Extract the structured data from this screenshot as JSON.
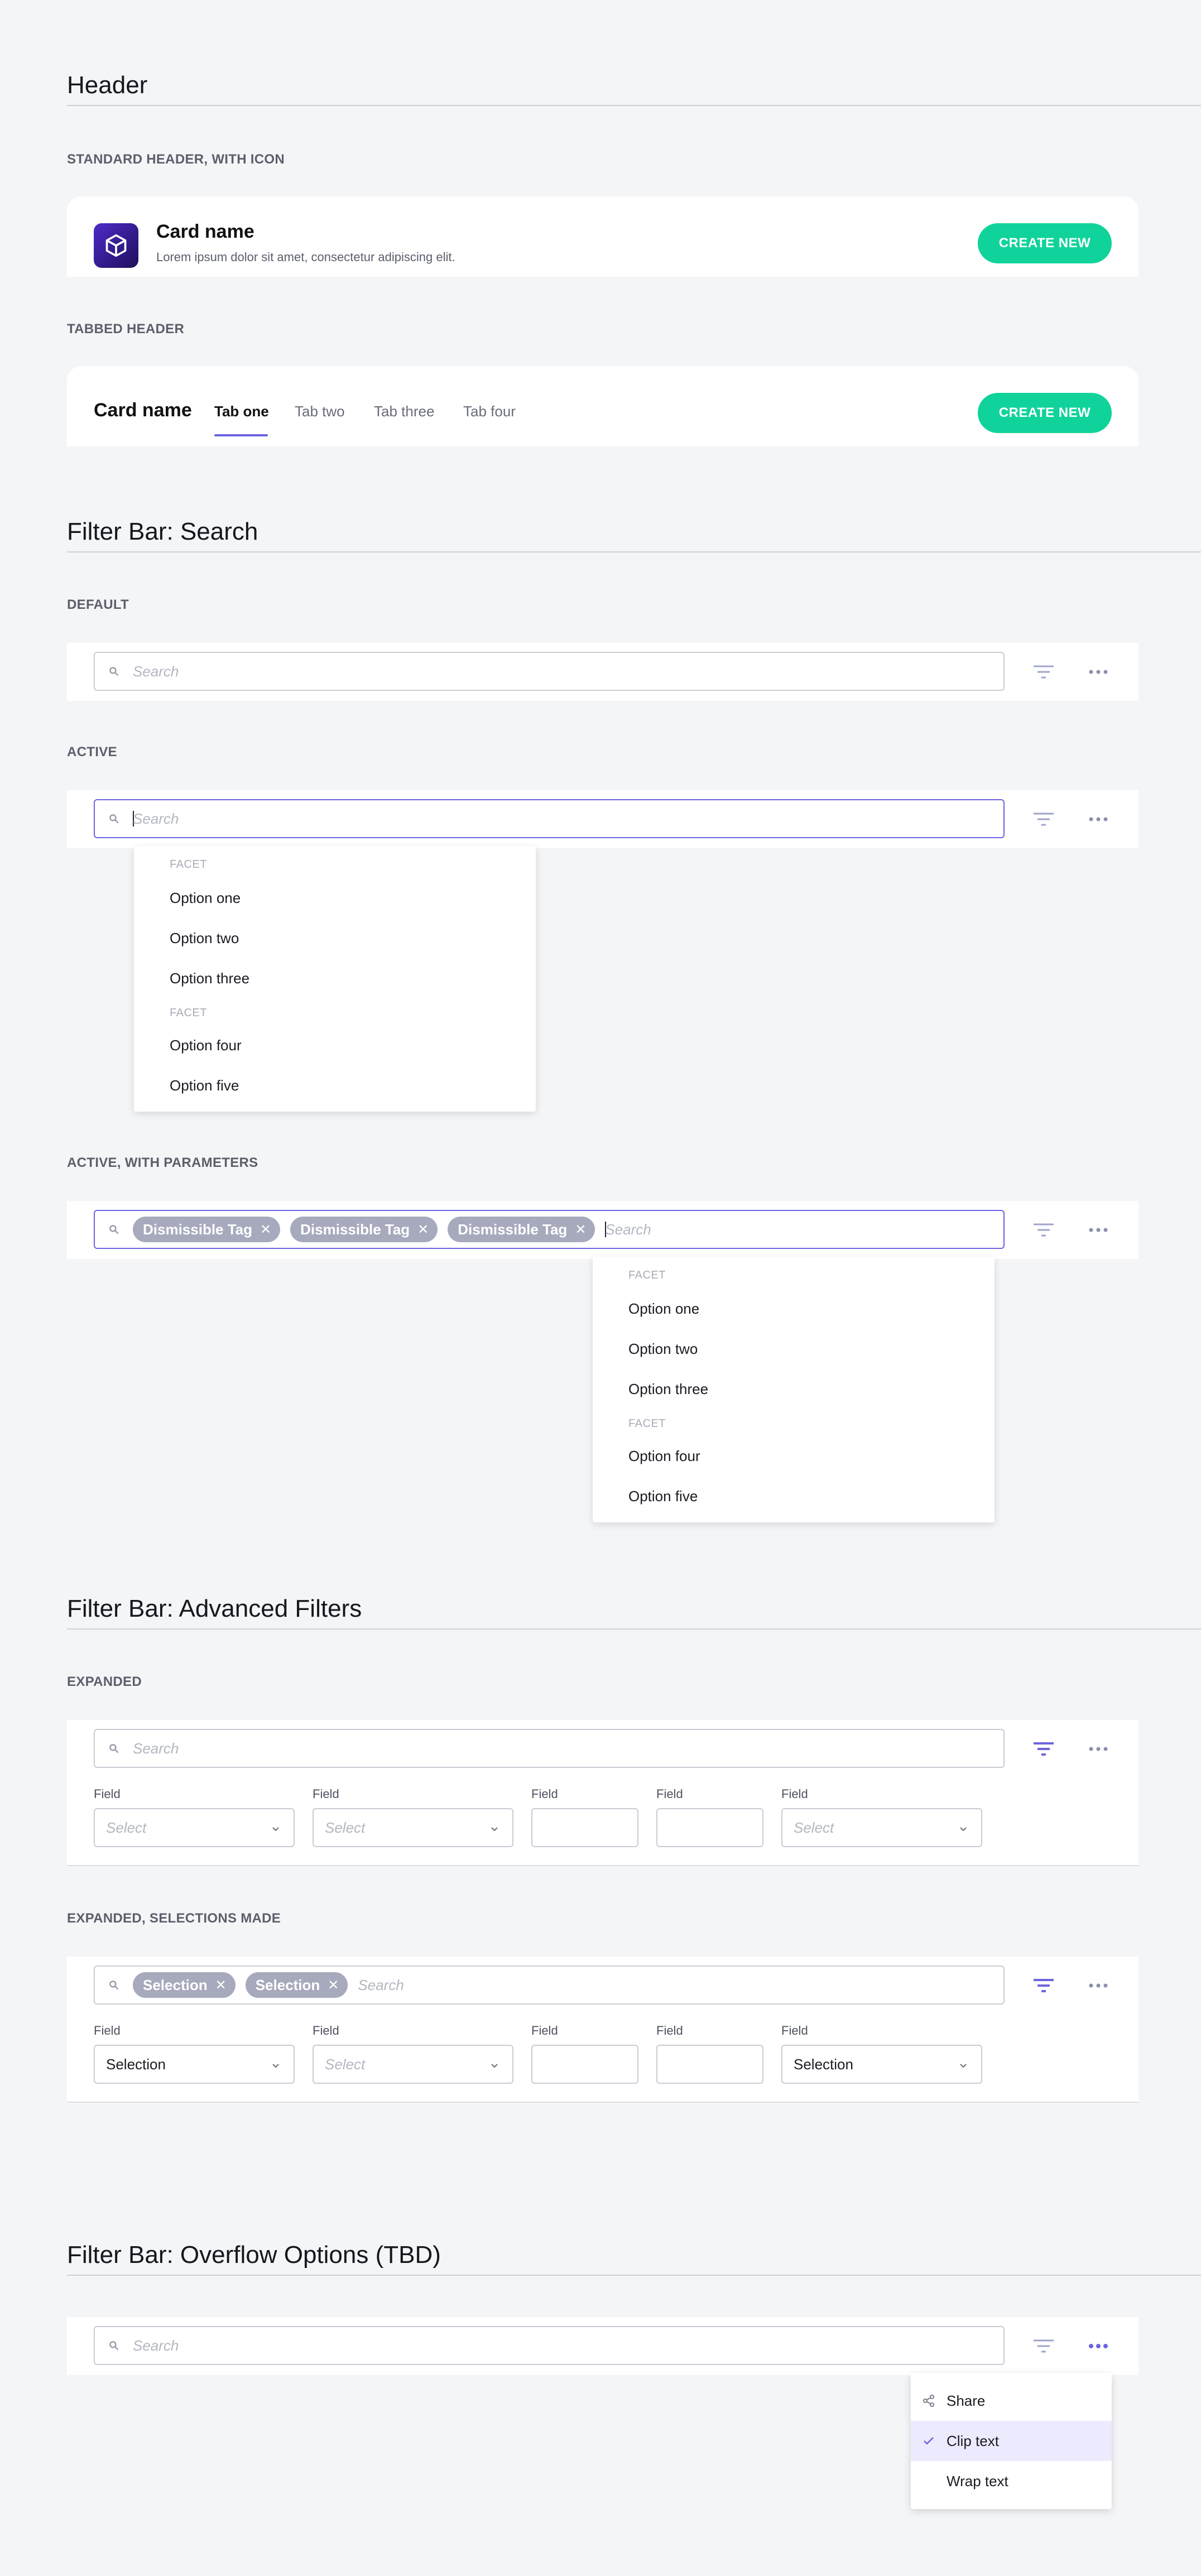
{
  "header_section": {
    "title": "Header",
    "standard": {
      "label": "STANDARD HEADER, WITH ICON",
      "card_name": "Card name",
      "description": "Lorem ipsum dolor sit amet, consectetur adipiscing elit.",
      "button": "CREATE NEW"
    },
    "tabbed": {
      "label": "TABBED HEADER",
      "card_name": "Card name",
      "tabs": [
        "Tab one",
        "Tab two",
        "Tab three",
        "Tab four"
      ],
      "button": "CREATE NEW"
    }
  },
  "search_section": {
    "title": "Filter Bar: Search",
    "default_label": "DEFAULT",
    "active_label": "ACTIVE",
    "params_label": "ACTIVE, WITH PARAMETERS",
    "placeholder": "Search",
    "tags": [
      "Dismissible Tag",
      "Dismissible Tag",
      "Dismissible Tag"
    ],
    "dropdown": {
      "facet_1": "FACET",
      "facet_2": "FACET",
      "options": [
        "Option one",
        "Option two",
        "Option three",
        "Option four",
        "Option five"
      ]
    }
  },
  "advanced_section": {
    "title": "Filter Bar: Advanced Filters",
    "expanded_label": "EXPANDED",
    "selections_label": "EXPANDED, SELECTIONS MADE",
    "placeholder": "Search",
    "field_label": "Field",
    "select_placeholder": "Select",
    "selection_value": "Selection",
    "selection_tags": [
      "Selection",
      "Selection"
    ]
  },
  "overflow_section": {
    "title": "Filter Bar: Overflow Options (TBD)",
    "placeholder": "Search",
    "menu": [
      "Share",
      "Clip text",
      "Wrap text"
    ]
  },
  "colors": {
    "accent": "#6b64e0",
    "create_button": "#0fd39a",
    "tag": "#a7aabd",
    "selected_menu": "#eceafd"
  }
}
